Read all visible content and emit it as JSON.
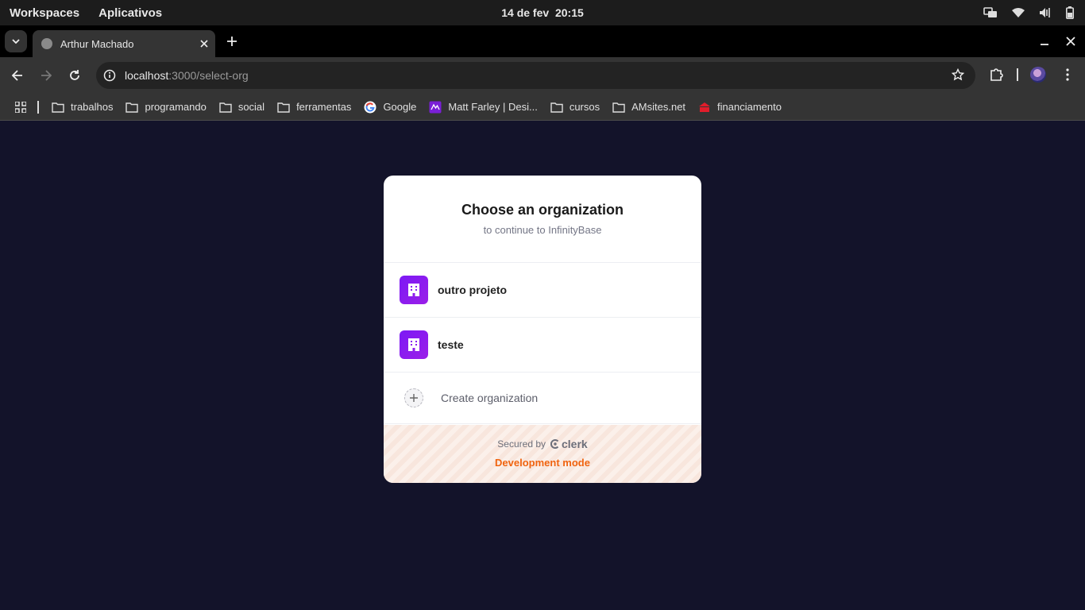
{
  "system_bar": {
    "workspaces": "Workspaces",
    "apps": "Aplicativos",
    "date": "14 de fev",
    "time": "20:15"
  },
  "browser": {
    "tab_title": "Arthur Machado",
    "url_host": "localhost",
    "url_path": ":3000/select-org",
    "bookmarks": [
      {
        "label": "trabalhos",
        "icon": "folder-icon"
      },
      {
        "label": "programando",
        "icon": "folder-icon"
      },
      {
        "label": "social",
        "icon": "folder-icon"
      },
      {
        "label": "ferramentas",
        "icon": "folder-icon"
      },
      {
        "label": "Google",
        "icon": "google-icon"
      },
      {
        "label": "Matt Farley | Desi...",
        "icon": "site-icon"
      },
      {
        "label": "cursos",
        "icon": "folder-icon"
      },
      {
        "label": "AMsites.net",
        "icon": "folder-icon"
      },
      {
        "label": "financiamento",
        "icon": "bank-icon"
      }
    ]
  },
  "card": {
    "title": "Choose an organization",
    "subtitle": "to continue to InfinityBase",
    "organizations": [
      {
        "name": "outro projeto"
      },
      {
        "name": "teste"
      }
    ],
    "create_label": "Create organization",
    "secured_by": "Secured by",
    "brand": "clerk",
    "dev_mode": "Development mode"
  },
  "colors": {
    "page_bg": "#13132a",
    "org_accent": "#8a1cf0",
    "dev_mode": "#f06410"
  }
}
